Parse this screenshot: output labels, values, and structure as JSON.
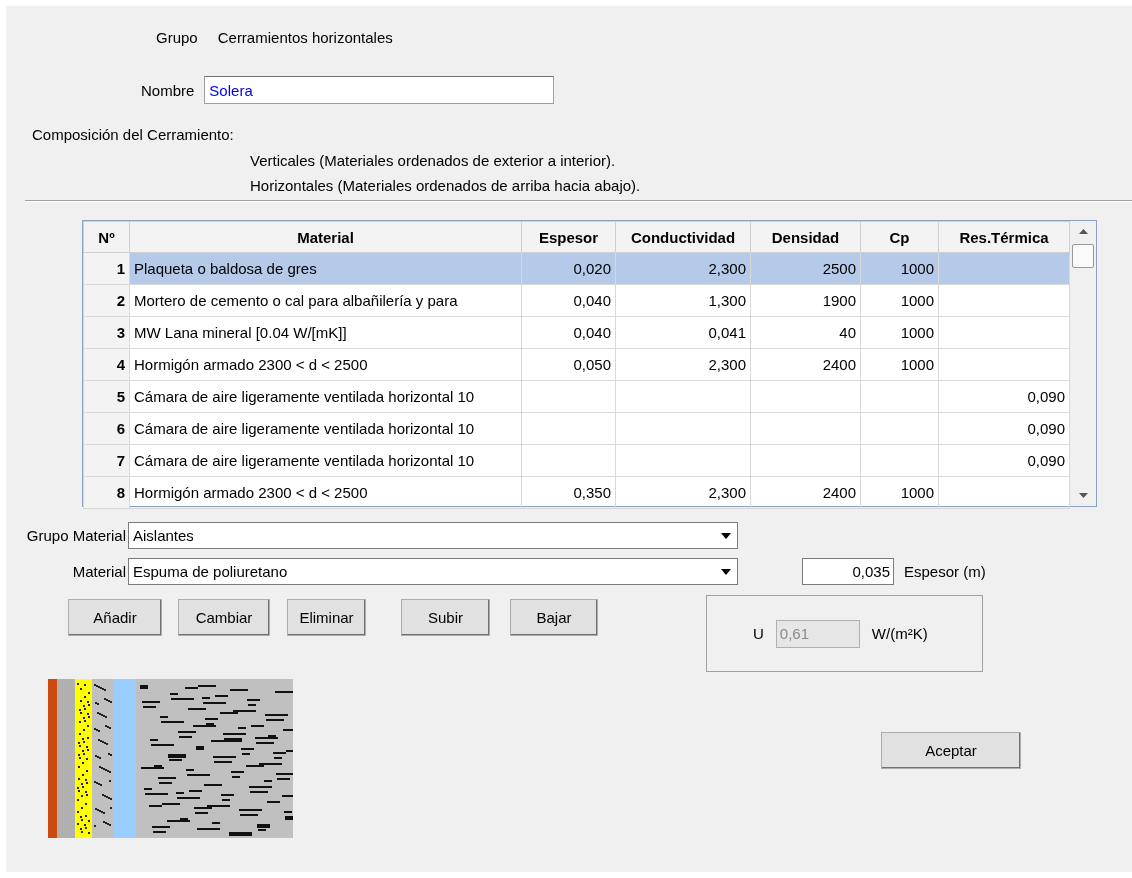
{
  "group": {
    "label": "Grupo",
    "value": "Cerramientos horizontales"
  },
  "name_field": {
    "label": "Nombre",
    "value": "Solera"
  },
  "composition": {
    "title": "Composición del Cerramiento:",
    "notes": [
      "Verticales (Materiales ordenados de exterior a interior).",
      "Horizontales (Materiales ordenados de arriba hacia abajo)."
    ]
  },
  "table": {
    "columns": [
      "Nº",
      "Material",
      "Espesor",
      "Conductividad",
      "Densidad",
      "Cp",
      "Res.Térmica"
    ],
    "rows": [
      {
        "n": "1",
        "material": "Plaqueta o baldosa de gres",
        "espesor": "0,020",
        "conductividad": "2,300",
        "densidad": "2500",
        "cp": "1000",
        "selected": true
      },
      {
        "n": "2",
        "material": "Mortero de cemento o cal para albañilería y para",
        "espesor": "0,040",
        "conductividad": "1,300",
        "densidad": "1900",
        "cp": "1000",
        "selected": false
      },
      {
        "n": "3",
        "material": "MW Lana mineral [0.04 W/[mK]]",
        "espesor": "0,040",
        "conductividad": "0,041",
        "densidad": "40",
        "cp": "1000",
        "selected": false
      },
      {
        "n": "4",
        "material": "Hormigón armado 2300 < d < 2500",
        "espesor": "0,050",
        "conductividad": "2,300",
        "densidad": "2400",
        "cp": "1000",
        "selected": false
      },
      {
        "n": "5",
        "material": "Cámara de aire ligeramente ventilada horizontal 10",
        "res_termica": "0,090",
        "selected": false
      },
      {
        "n": "6",
        "material": "Cámara de aire ligeramente ventilada horizontal 10",
        "res_termica": "0,090",
        "selected": false
      },
      {
        "n": "7",
        "material": "Cámara de aire ligeramente ventilada horizontal 10",
        "res_termica": "0,090",
        "selected": false
      },
      {
        "n": "8",
        "material": "Hormigón armado 2300 < d < 2500",
        "espesor": "0,350",
        "conductividad": "2,300",
        "densidad": "2400",
        "cp": "1000",
        "selected": false
      }
    ]
  },
  "group_material": {
    "label": "Grupo Material",
    "value": "Aislantes"
  },
  "material": {
    "label": "Material",
    "value": "Espuma de poliuretano"
  },
  "thickness": {
    "value": "0,035",
    "label": "Espesor (m)"
  },
  "buttons": [
    "Añadir",
    "Cambiar",
    "Eliminar",
    "Subir",
    "Bajar"
  ],
  "u_value": {
    "label": "U",
    "value": "0,61",
    "unit": "W/(m²K)",
    "disabled": true
  },
  "accept_button": "Aceptar"
}
